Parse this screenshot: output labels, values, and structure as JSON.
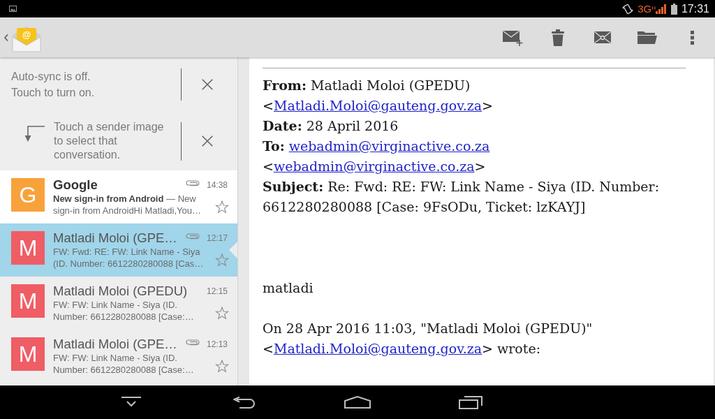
{
  "status_bar": {
    "network": "3G",
    "network_badge": "H",
    "time": "17:31"
  },
  "action_bar": {
    "app_icon_symbol": "@"
  },
  "tips": [
    {
      "kind": "sync",
      "lines": [
        "Auto-sync is off.",
        "Touch to turn on."
      ]
    },
    {
      "kind": "hint",
      "lines": [
        "Touch a sender image to select that conversation."
      ]
    }
  ],
  "conversations": [
    {
      "avatar": {
        "letter": "G",
        "color": "#f8a23b"
      },
      "sender": "Google",
      "attachment": true,
      "time": "14:38",
      "snippet": "**New sign-in from Android** — New sign-in from AndroidHi Matladi,You…",
      "starred": false,
      "unread": true,
      "selected": false
    },
    {
      "avatar": {
        "letter": "M",
        "color": "#ef5d65"
      },
      "sender": "Matladi Moloi (GPE…",
      "attachment": true,
      "time": "12:17",
      "snippet": "FW: Fwd: RE: FW: Link Name - Siya (ID. Number: 6612280280088 [Cas…",
      "starred": false,
      "unread": false,
      "selected": true
    },
    {
      "avatar": {
        "letter": "M",
        "color": "#ef5d65"
      },
      "sender": "Matladi Moloi (GPEDU)",
      "attachment": false,
      "time": "12:15",
      "snippet": "FW: FW: Link Name - Siya (ID. Number: 6612280280088 [Case:…",
      "starred": false,
      "unread": false,
      "selected": false
    },
    {
      "avatar": {
        "letter": "M",
        "color": "#ef5d65"
      },
      "sender": "Matladi Moloi (GPE…",
      "attachment": true,
      "time": "12:13",
      "snippet": "FW: FW: Link Name - Siya (ID. Number: 6612280280088 [Case:…",
      "starred": false,
      "unread": false,
      "selected": false
    }
  ],
  "message": {
    "paragraphs": [
      {
        "kind": "header",
        "segments": [
          {
            "kind": "text",
            "text": "**From:** Matladi Moloi (GPEDU) <"
          },
          {
            "kind": "link",
            "text": "Matladi.Moloi@gauteng.gov.za"
          },
          {
            "kind": "text",
            "text": ">"
          }
        ]
      },
      {
        "kind": "header",
        "segments": [
          {
            "kind": "text",
            "text": "**Date:** 28 April 2016"
          }
        ]
      },
      {
        "kind": "header",
        "segments": [
          {
            "kind": "text",
            "text": "**To:** "
          },
          {
            "kind": "link",
            "text": "webadmin@virginactive.co.za"
          },
          {
            "kind": "text",
            "text": " <"
          },
          {
            "kind": "link",
            "text": "webadmin@virginactive.co.za"
          },
          {
            "kind": "text",
            "text": ">"
          }
        ]
      },
      {
        "kind": "header",
        "segments": [
          {
            "kind": "text",
            "text": "**Subject:** Re: Fwd: RE: FW: Link Name - Siya (ID. Number: 6612280280088 [Case: 9FsODu, Ticket: lzKAYJ]"
          }
        ]
      },
      {
        "kind": "signature",
        "segments": [
          {
            "kind": "text",
            "text": "matladi"
          }
        ]
      },
      {
        "kind": "quote",
        "segments": [
          {
            "kind": "text",
            "text": "On 28 Apr 2016 11:03, \"Matladi Moloi (GPEDU)\" <"
          },
          {
            "kind": "link",
            "text": "Matladi.Moloi@gauteng.gov.za"
          },
          {
            "kind": "text",
            "text": "> wrote:"
          }
        ]
      }
    ]
  }
}
